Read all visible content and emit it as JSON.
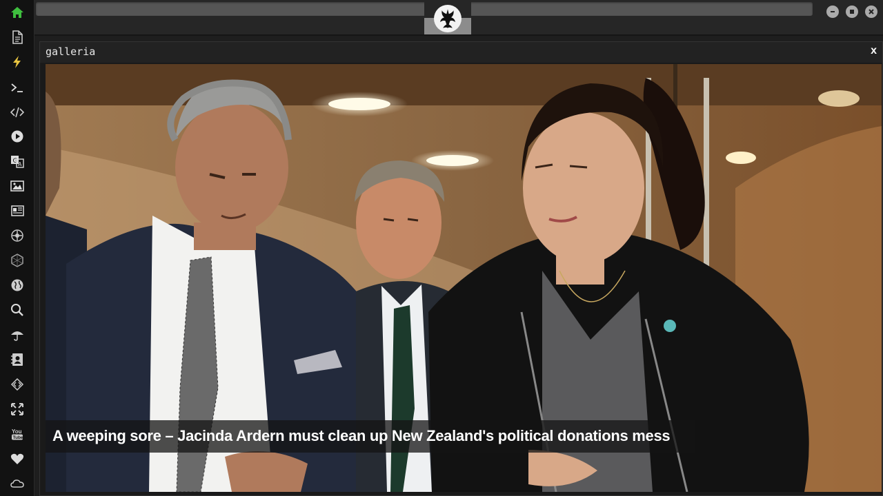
{
  "sidebar": {
    "items": [
      {
        "icon": "home-icon",
        "label": "Home"
      },
      {
        "icon": "document-icon",
        "label": "Document"
      },
      {
        "icon": "lightning-icon",
        "label": "Lightning"
      },
      {
        "icon": "terminal-icon",
        "label": "Terminal"
      },
      {
        "icon": "code-icon",
        "label": "Code"
      },
      {
        "icon": "play-icon",
        "label": "Play"
      },
      {
        "icon": "translate-icon",
        "label": "Translate"
      },
      {
        "icon": "image-icon",
        "label": "Images"
      },
      {
        "icon": "news-icon",
        "label": "News"
      },
      {
        "icon": "rebel-icon",
        "label": "Rebel"
      },
      {
        "icon": "hexagon-icon",
        "label": "Hexagon"
      },
      {
        "icon": "globe-icon",
        "label": "Globe"
      },
      {
        "icon": "search-icon",
        "label": "Search"
      },
      {
        "icon": "umbrella-icon",
        "label": "Umbrella"
      },
      {
        "icon": "contacts-icon",
        "label": "Contacts"
      },
      {
        "icon": "diamond-code-icon",
        "label": "Diamond"
      },
      {
        "icon": "expand-icon",
        "label": "Expand"
      },
      {
        "icon": "youtube-icon",
        "label": "YouTube"
      },
      {
        "icon": "heart-icon",
        "label": "Favorites"
      },
      {
        "icon": "cloud-icon",
        "label": "Cloud"
      }
    ],
    "active_color": "#3fbf3f",
    "accent_color": "#e8c440"
  },
  "topbar": {
    "emblem_icon": "rebel-alliance-icon",
    "window_buttons": [
      "minimize-icon",
      "maximize-icon",
      "close-icon"
    ]
  },
  "panel": {
    "title": "galleria",
    "close_label": "x"
  },
  "gallery": {
    "caption": "A weeping sore – Jacinda Ardern must clean up New Zealand's political donations mess"
  }
}
